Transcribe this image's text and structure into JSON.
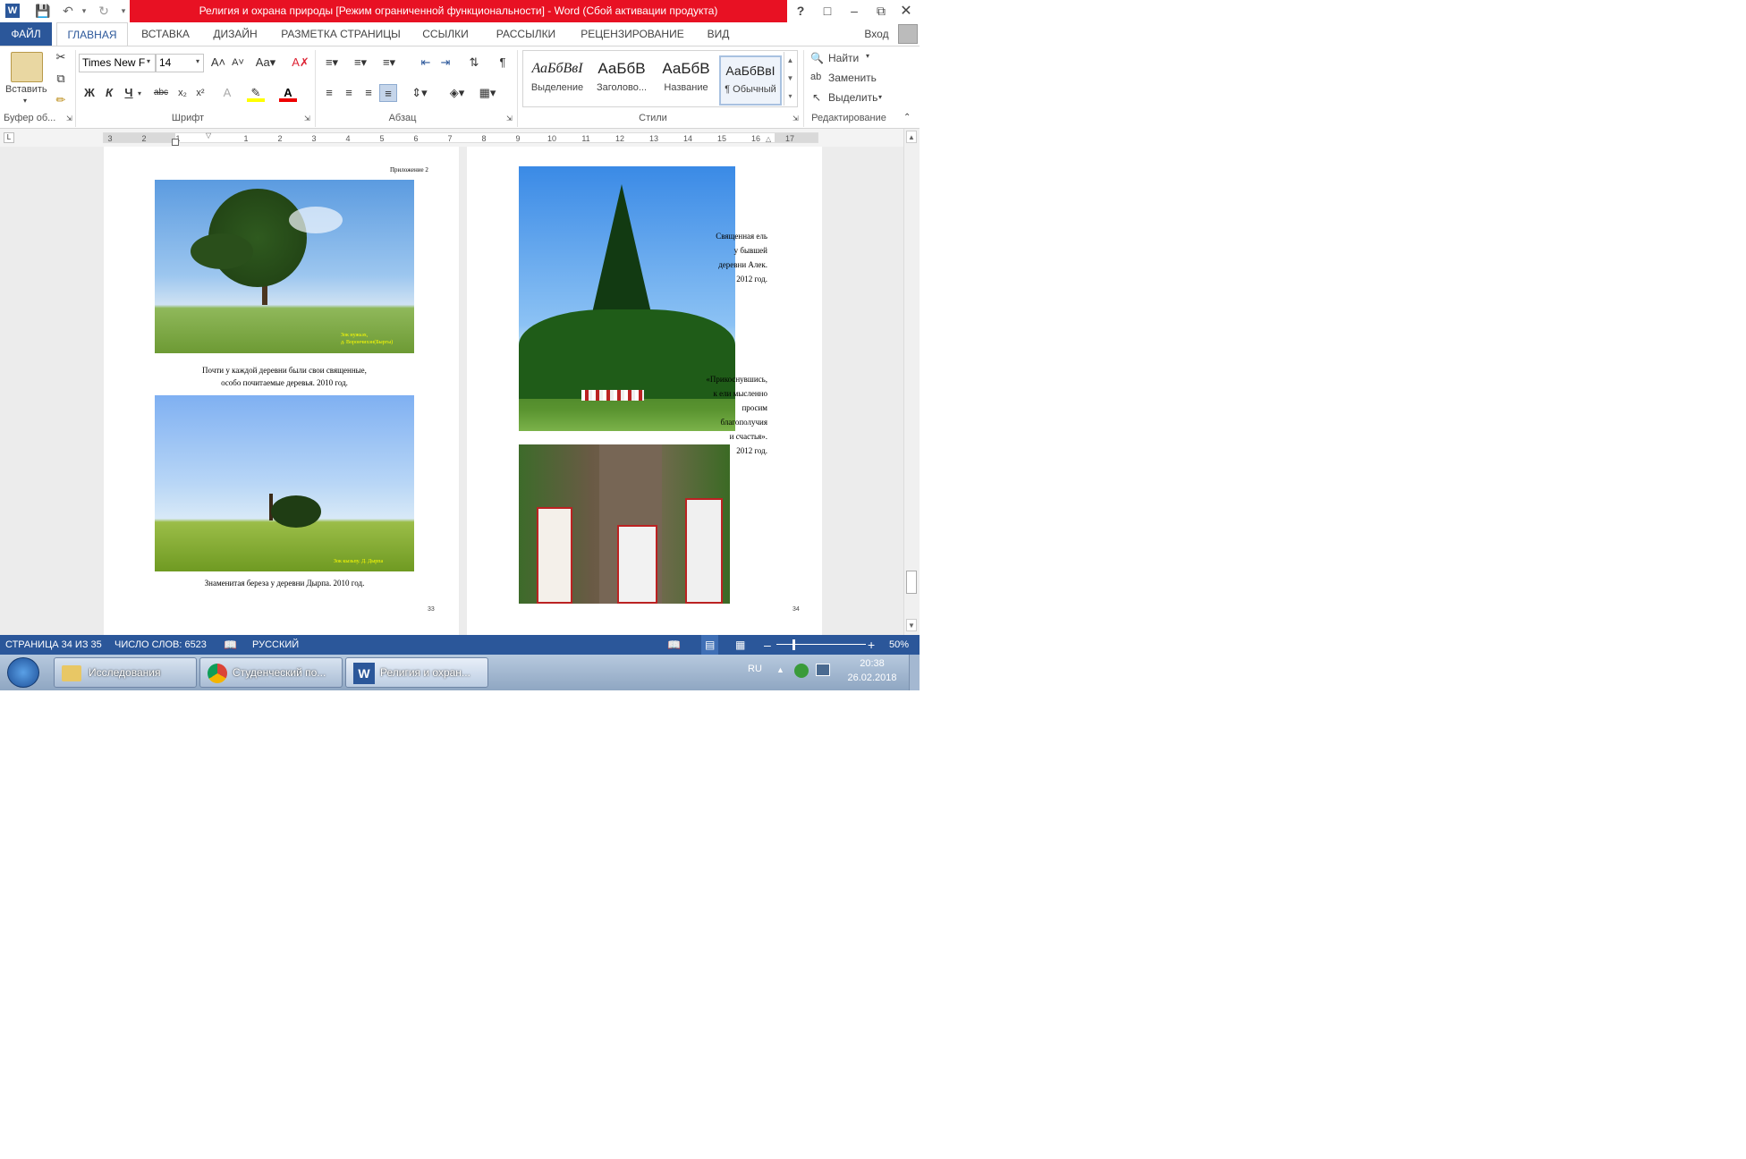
{
  "app": {
    "title": "Религия и охрана природы [Режим ограниченной функциональности] - Word (Сбой активации продукта)",
    "help": "?",
    "signin": "Вход"
  },
  "tabs": [
    "ФАЙЛ",
    "ГЛАВНАЯ",
    "ВСТАВКА",
    "ДИЗАЙН",
    "РАЗМЕТКА СТРАНИЦЫ",
    "ССЫЛКИ",
    "РАССЫЛКИ",
    "РЕЦЕНЗИРОВАНИЕ",
    "ВИД"
  ],
  "ribbon": {
    "paste_label": "Вставить",
    "font_name": "Times New F",
    "font_size": "14",
    "groups": {
      "clipboard": "Буфер об...",
      "font": "Шрифт",
      "paragraph": "Абзац",
      "styles": "Стили",
      "editing": "Редактирование"
    },
    "styles": [
      {
        "preview": "АаБбВвІ",
        "name": "Выделение"
      },
      {
        "preview": "АаБбВ",
        "name": "Заголово..."
      },
      {
        "preview": "АаБбВ",
        "name": "Название"
      },
      {
        "preview": "АаБбВвІ",
        "name": "¶ Обычный"
      }
    ],
    "editing": {
      "find": "Найти",
      "replace": "Заменить",
      "select": "Выделить"
    },
    "font_buttons": {
      "bold": "Ж",
      "italic": "К",
      "underline": "Ч",
      "strike": "abc",
      "sub": "x₂",
      "sup": "x²"
    }
  },
  "ruler": {
    "marks": [
      "3",
      "2",
      "1",
      "1",
      "2",
      "3",
      "4",
      "5",
      "6",
      "7",
      "8",
      "9",
      "10",
      "11",
      "12",
      "13",
      "14",
      "15",
      "16",
      "17"
    ]
  },
  "doc": {
    "page1": {
      "header": "Приложение 2",
      "img1_watermark_1": "Зок нужьэх,",
      "img1_watermark_2": "д. Ворончихэн(Быргы)",
      "caption1_line1": "Почти у каждой деревни были свои священные,",
      "caption1_line2": "особо почитаемые деревья.  2010 год.",
      "img2_watermark": "Зок кызьпу. Д. Дырпа",
      "caption2": "Знаменитая береза у деревни Дырпа. 2010 год.",
      "page_number": "33"
    },
    "page2": {
      "caption1": [
        "Священная ель",
        "у бывшей",
        "деревни Алек.",
        "2012 год."
      ],
      "caption2": [
        "«Прикоснувшись,",
        "к ели мысленно",
        "просим",
        "благополучия",
        "и счастья».",
        "2012 год."
      ],
      "page_number": "34"
    }
  },
  "status": {
    "page": "СТРАНИЦА 34 ИЗ 35",
    "words": "ЧИСЛО СЛОВ: 6523",
    "language": "РУССКИЙ",
    "zoom": "50%"
  },
  "taskbar": {
    "items": [
      "Исследования",
      "Студенческий по...",
      "Религия и охран..."
    ],
    "lang": "RU",
    "time": "20:38",
    "date": "26.02.2018"
  },
  "colors": {
    "word_blue": "#2b579a",
    "title_red": "#e81123"
  }
}
